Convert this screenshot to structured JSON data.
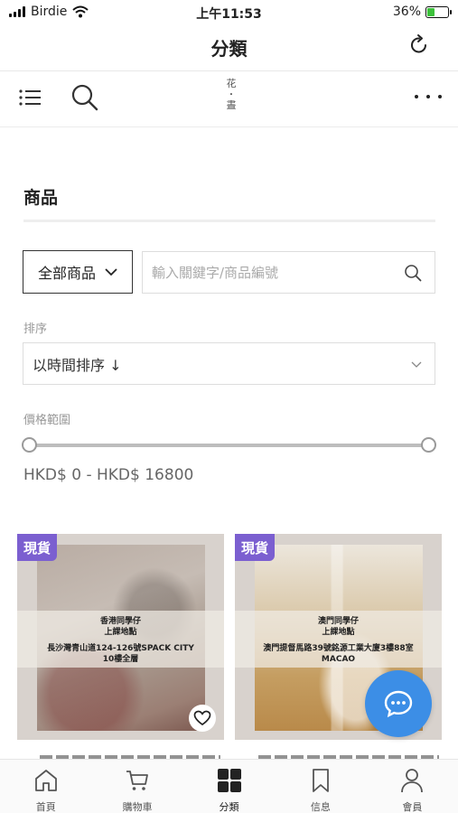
{
  "status_bar": {
    "carrier": "Birdie",
    "time": "上午11:53",
    "battery_percent": "36%",
    "battery_level": 0.36,
    "battery_color": "#3cc13b"
  },
  "nav": {
    "title": "分類",
    "refresh_icon": "refresh-icon"
  },
  "toolbar": {
    "menu_icon": "list-menu-icon",
    "search_icon": "search-icon",
    "logo_line1": "花",
    "logo_dot": "•",
    "logo_line2": "晝",
    "more_icon": "more-dots-icon"
  },
  "section": {
    "title": "商品"
  },
  "filters": {
    "category_value": "全部商品",
    "search_placeholder": "輸入關鍵字/商品編號",
    "sort_label": "排序",
    "sort_value": "以時間排序 ↓",
    "price_label": "價格範圍",
    "price_min": 0,
    "price_max": 16800,
    "price_range_text": "HKD$ 0 - HKD$ 16800"
  },
  "products": [
    {
      "badge": "現貨",
      "overlay_title": "香港同學仔",
      "overlay_sub": "上課地點",
      "overlay_address_1": "長沙灣青山道124-126號SPACK CITY",
      "overlay_address_2": "10樓全層",
      "wishlist_icon": "heart-icon"
    },
    {
      "badge": "現貨",
      "overlay_title": "澳門同學仔",
      "overlay_sub": "上課地點",
      "overlay_address_1": "澳門提督馬路39號銘源工業大廈3樓88室",
      "overlay_address_2": "MACAO"
    }
  ],
  "chat": {
    "icon": "chat-bubble-icon",
    "color": "#3c8ee6"
  },
  "badge_color": "#7b5fd0",
  "tab_bar": {
    "tabs": [
      {
        "label": "首頁",
        "icon": "home-icon"
      },
      {
        "label": "購物車",
        "icon": "cart-icon"
      },
      {
        "label": "分類",
        "icon": "grid-icon",
        "active": true
      },
      {
        "label": "信息",
        "icon": "bookmark-icon"
      },
      {
        "label": "會員",
        "icon": "user-icon"
      }
    ]
  }
}
